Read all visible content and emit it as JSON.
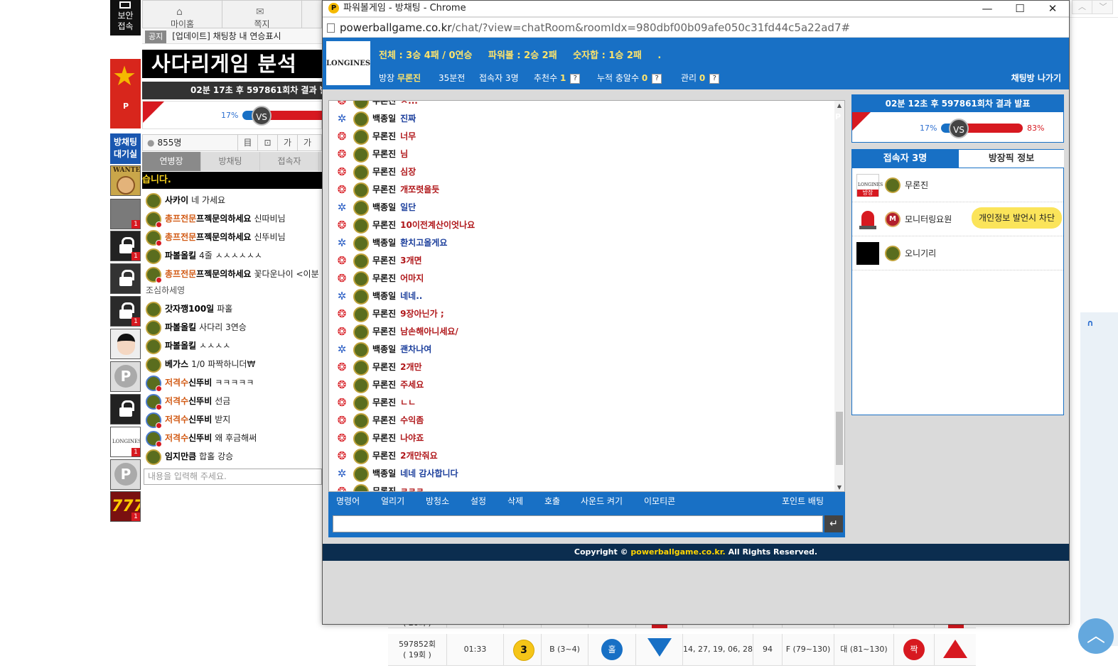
{
  "bg": {
    "security_label": "보안\n접속",
    "waiting_label": "방채팅\n대기실",
    "nav": {
      "home": "마이홈",
      "note": "쪽지"
    },
    "notice": {
      "tag": "공지",
      "text": "[업데이트] 채팅창 내 연승표시"
    },
    "ladder_title": "사다리게임 분석",
    "round_text": "02분 17초 후 597861회차 결과 발",
    "vs": {
      "left_pct": "17%",
      "label": "VS"
    },
    "user_count": "855명",
    "tools": [
      "目",
      "⊡",
      "가",
      "가"
    ],
    "tabs": [
      "연병장",
      "방채팅",
      "접속자"
    ],
    "ticker": "습니다.",
    "thumb_badge": "1",
    "chat": [
      {
        "user": "사카이",
        "orange": "",
        "msg": "네 가세요"
      },
      {
        "user": "프젝문의하세요",
        "orange": "총프전문",
        "msg": "신따비님"
      },
      {
        "user": "프젝문의하세요",
        "orange": "총프전문",
        "msg": "신뚜비님"
      },
      {
        "user": "파볼올킬",
        "orange": "",
        "msg": "4줄 ㅅㅅㅅㅅㅅㅅ"
      },
      {
        "user": "프젝문의하세요",
        "orange": "총프전문",
        "msg": "꽃다운나이 <이분"
      },
      {
        "user": "",
        "orange": "",
        "msg": "조심하세영"
      },
      {
        "user": "갓자깽100일",
        "orange": "",
        "msg": "파홀"
      },
      {
        "user": "파볼올킬",
        "orange": "",
        "msg": "사다리 3연승"
      },
      {
        "user": "파볼올킬",
        "orange": "",
        "msg": "ㅅㅅㅅㅅ"
      },
      {
        "user": "베가스",
        "orange": "",
        "msg": "1/0 파짝하니더₩"
      },
      {
        "user": "신뚜비",
        "orange": "저격수",
        "msg": "ㅋㅋㅋㅋㅋ"
      },
      {
        "user": "신뚜비",
        "orange": "저격수",
        "msg": "선금"
      },
      {
        "user": "신뚜비",
        "orange": "저격수",
        "msg": "받지"
      },
      {
        "user": "신뚜비",
        "orange": "저격수",
        "msg": "왜 후금해써"
      },
      {
        "user": "임지만큼",
        "orange": "",
        "msg": "합홀 강승"
      }
    ],
    "input_placeholder": "내용을 입력해 주세요.",
    "table": {
      "row0": {
        "round": "( 20회 )"
      },
      "row1": {
        "round": "597852회",
        "sub": "( 19회 )",
        "time": "01:33",
        "ball": "3",
        "range": "B (3~4)",
        "oe": "홀",
        "nums": "14, 27, 19, 06, 28",
        "sum": "94",
        "sumrange": "F (79~130)",
        "size": "대 (81~130)",
        "oe2": "짝"
      }
    }
  },
  "window": {
    "title": "파워볼게임 - 방채팅 - Chrome",
    "url_host": "powerballgame.co.kr",
    "url_path": "/chat/?view=chatRoom&roomIdx=980dbf00b09afe050c31fd44c5a22ad7#",
    "logo_text": "LONGINES",
    "stats": [
      "전체 : 3승 4패 / 0연승",
      "파워볼 : 2승 2패",
      "숫자합 : 1승 2패",
      "."
    ],
    "info": {
      "host_label": "방장",
      "host_name": "무론진",
      "game": "35분전",
      "users": "접속자 3명",
      "rec_label": "추천수",
      "rec_val": "1",
      "acc_label": "누적 충알수",
      "acc_val": "0",
      "mgr_label": "관리",
      "mgr_val": "0",
      "q": "?"
    },
    "leave": "채팅방 나가기",
    "messages": [
      {
        "side": "r",
        "name": "무론진",
        "text": "ㅈ..."
      },
      {
        "side": "b",
        "name": "백종일",
        "text": "진짜"
      },
      {
        "side": "r",
        "name": "무론진",
        "text": "너무"
      },
      {
        "side": "r",
        "name": "무론진",
        "text": "님"
      },
      {
        "side": "r",
        "name": "무론진",
        "text": "심장"
      },
      {
        "side": "r",
        "name": "무론진",
        "text": "개쪼렷을듯"
      },
      {
        "side": "b",
        "name": "백종일",
        "text": "일단"
      },
      {
        "side": "r",
        "name": "무론진",
        "text": "10이전계산이엇나요"
      },
      {
        "side": "b",
        "name": "백종일",
        "text": "환치고올게요"
      },
      {
        "side": "r",
        "name": "무론진",
        "text": "3개면"
      },
      {
        "side": "r",
        "name": "무론진",
        "text": "어마지"
      },
      {
        "side": "b",
        "name": "백종일",
        "text": "네네.."
      },
      {
        "side": "r",
        "name": "무론진",
        "text": "9장아닌가 ;"
      },
      {
        "side": "r",
        "name": "무론진",
        "text": "남손해아니세요/"
      },
      {
        "side": "b",
        "name": "백종일",
        "text": "괜차나여"
      },
      {
        "side": "r",
        "name": "무론진",
        "text": "2개만"
      },
      {
        "side": "r",
        "name": "무론진",
        "text": "주세요"
      },
      {
        "side": "r",
        "name": "무론진",
        "text": "ㄴㄴ"
      },
      {
        "side": "r",
        "name": "무론진",
        "text": "수익좀"
      },
      {
        "side": "r",
        "name": "무론진",
        "text": "나야죠"
      },
      {
        "side": "r",
        "name": "무론진",
        "text": "2개만줘요"
      },
      {
        "side": "b",
        "name": "백종일",
        "text": "네네 감사합니다"
      },
      {
        "side": "r",
        "name": "무론진",
        "text": "ㅋㅋㅋ"
      }
    ],
    "tools": [
      "명령어",
      "얼리기",
      "방청소",
      "설정",
      "삭제",
      "호출",
      "사운드 켜기",
      "이모티콘"
    ],
    "point_bet": "포인트 배팅",
    "send_icon": "↵",
    "copyright_pre": "Copyright © ",
    "copyright_site": "powerballgame.co.kr.",
    "copyright_post": " All Rights Reserved.",
    "round_text": "02분 12초 후 597861회차 결과 발표",
    "vs": {
      "left_pct": "17%",
      "right_pct": "83%",
      "label": "VS",
      "left_value": 17,
      "right_value": 83
    },
    "tabs": {
      "users": "접속자 3명",
      "info": "방장픽 정보"
    },
    "users": [
      {
        "name": "무론진",
        "badge": "방장"
      },
      {
        "name": "모니터링요원",
        "rank": "M",
        "tip": "개인정보 발언시 차단"
      },
      {
        "name": "오니기리"
      }
    ]
  },
  "colors": {
    "brand_blue": "#1870c5",
    "red": "#d71920",
    "yellow": "#ffe46b",
    "footer": "#0b2d4f"
  }
}
